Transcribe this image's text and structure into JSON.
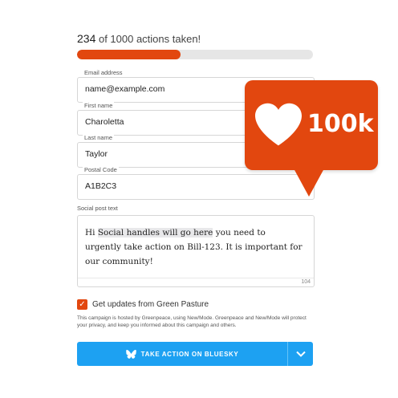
{
  "progress": {
    "count": "234",
    "label": " of 1000 actions taken!",
    "fraction": 0.44
  },
  "fields": [
    {
      "label": "Email address",
      "value": "name@example.com"
    },
    {
      "label": "First name",
      "value": "Charoletta"
    },
    {
      "label": "Last name",
      "value": "Taylor"
    },
    {
      "label": "Postal Code",
      "value": "A1B2C3"
    }
  ],
  "social_post": {
    "label": "Social post text",
    "text_before": "Hi ",
    "highlight": "Social handles will go here",
    "text_after": " you need to urgently take action on Bill-123. It is important for our community!",
    "char_count": "104"
  },
  "updates": {
    "label": "Get updates from Green Pasture",
    "checked": true
  },
  "disclaimer": "This campaign is hosted by Greenpeace, using New/Mode. Greenpeace and New/Mode will protect your privacy, and keep you informed about this campaign and others.",
  "cta": {
    "label": "TAKE ACTION ON BLUESKY",
    "icon": "butterfly-icon",
    "dropdown_icon": "chevron-down-icon"
  },
  "like_badge": {
    "count": "100k",
    "icon": "heart-icon"
  },
  "colors": {
    "accent": "#e2470f",
    "cta": "#1da1f2"
  }
}
